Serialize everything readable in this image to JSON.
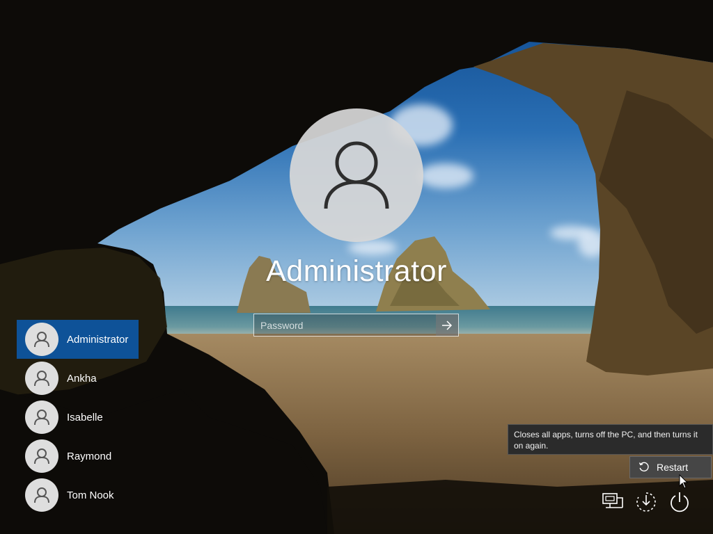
{
  "login": {
    "username": "Administrator",
    "password_placeholder": "Password",
    "password_value": ""
  },
  "users": [
    {
      "name": "Administrator",
      "selected": true
    },
    {
      "name": "Ankha",
      "selected": false
    },
    {
      "name": "Isabelle",
      "selected": false
    },
    {
      "name": "Raymond",
      "selected": false
    },
    {
      "name": "Tom Nook",
      "selected": false
    }
  ],
  "power_menu": {
    "tooltip": "Closes all apps, turns off the PC, and then turns it on again.",
    "restart_label": "Restart"
  },
  "icons": {
    "network": "network-icon",
    "accessibility": "ease-of-access-icon",
    "power": "power-icon",
    "restart": "restart-icon",
    "submit": "arrow-right-icon",
    "user": "user-icon"
  },
  "colors": {
    "selected_user": "#0e5298",
    "tooltip_bg": "#2b2b2b",
    "restart_bg": "#464646"
  }
}
